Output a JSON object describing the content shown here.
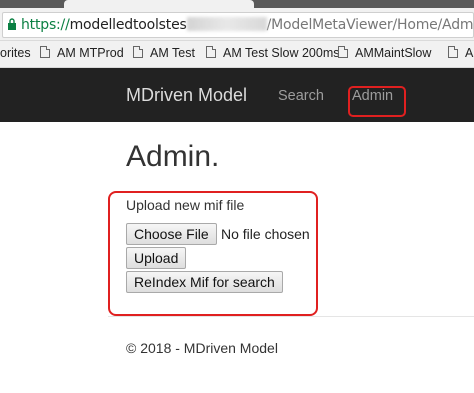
{
  "browser": {
    "url_protocol": "https://",
    "url_host_visible": "modelledtoolstes",
    "url_path": "/ModelMetaViewer/Home/Admin",
    "bookmarks": [
      {
        "label": "orites"
      },
      {
        "label": "AM MTProd"
      },
      {
        "label": "AM Test"
      },
      {
        "label": "AM Test Slow 200ms"
      },
      {
        "label": "AMMaintSlow"
      },
      {
        "label": "A"
      }
    ]
  },
  "navbar": {
    "brand": "MDriven Model",
    "links": [
      {
        "label": "Search"
      },
      {
        "label": "Admin"
      }
    ]
  },
  "page": {
    "title": "Admin.",
    "upload_label": "Upload new mif file",
    "choose_file": "Choose File",
    "no_file": "No file chosen",
    "upload_button": "Upload",
    "reindex_button": "ReIndex Mif for search",
    "footer": "© 2018 - MDriven Model"
  },
  "colors": {
    "navbar_bg": "#222222",
    "highlight": "#e02020"
  }
}
